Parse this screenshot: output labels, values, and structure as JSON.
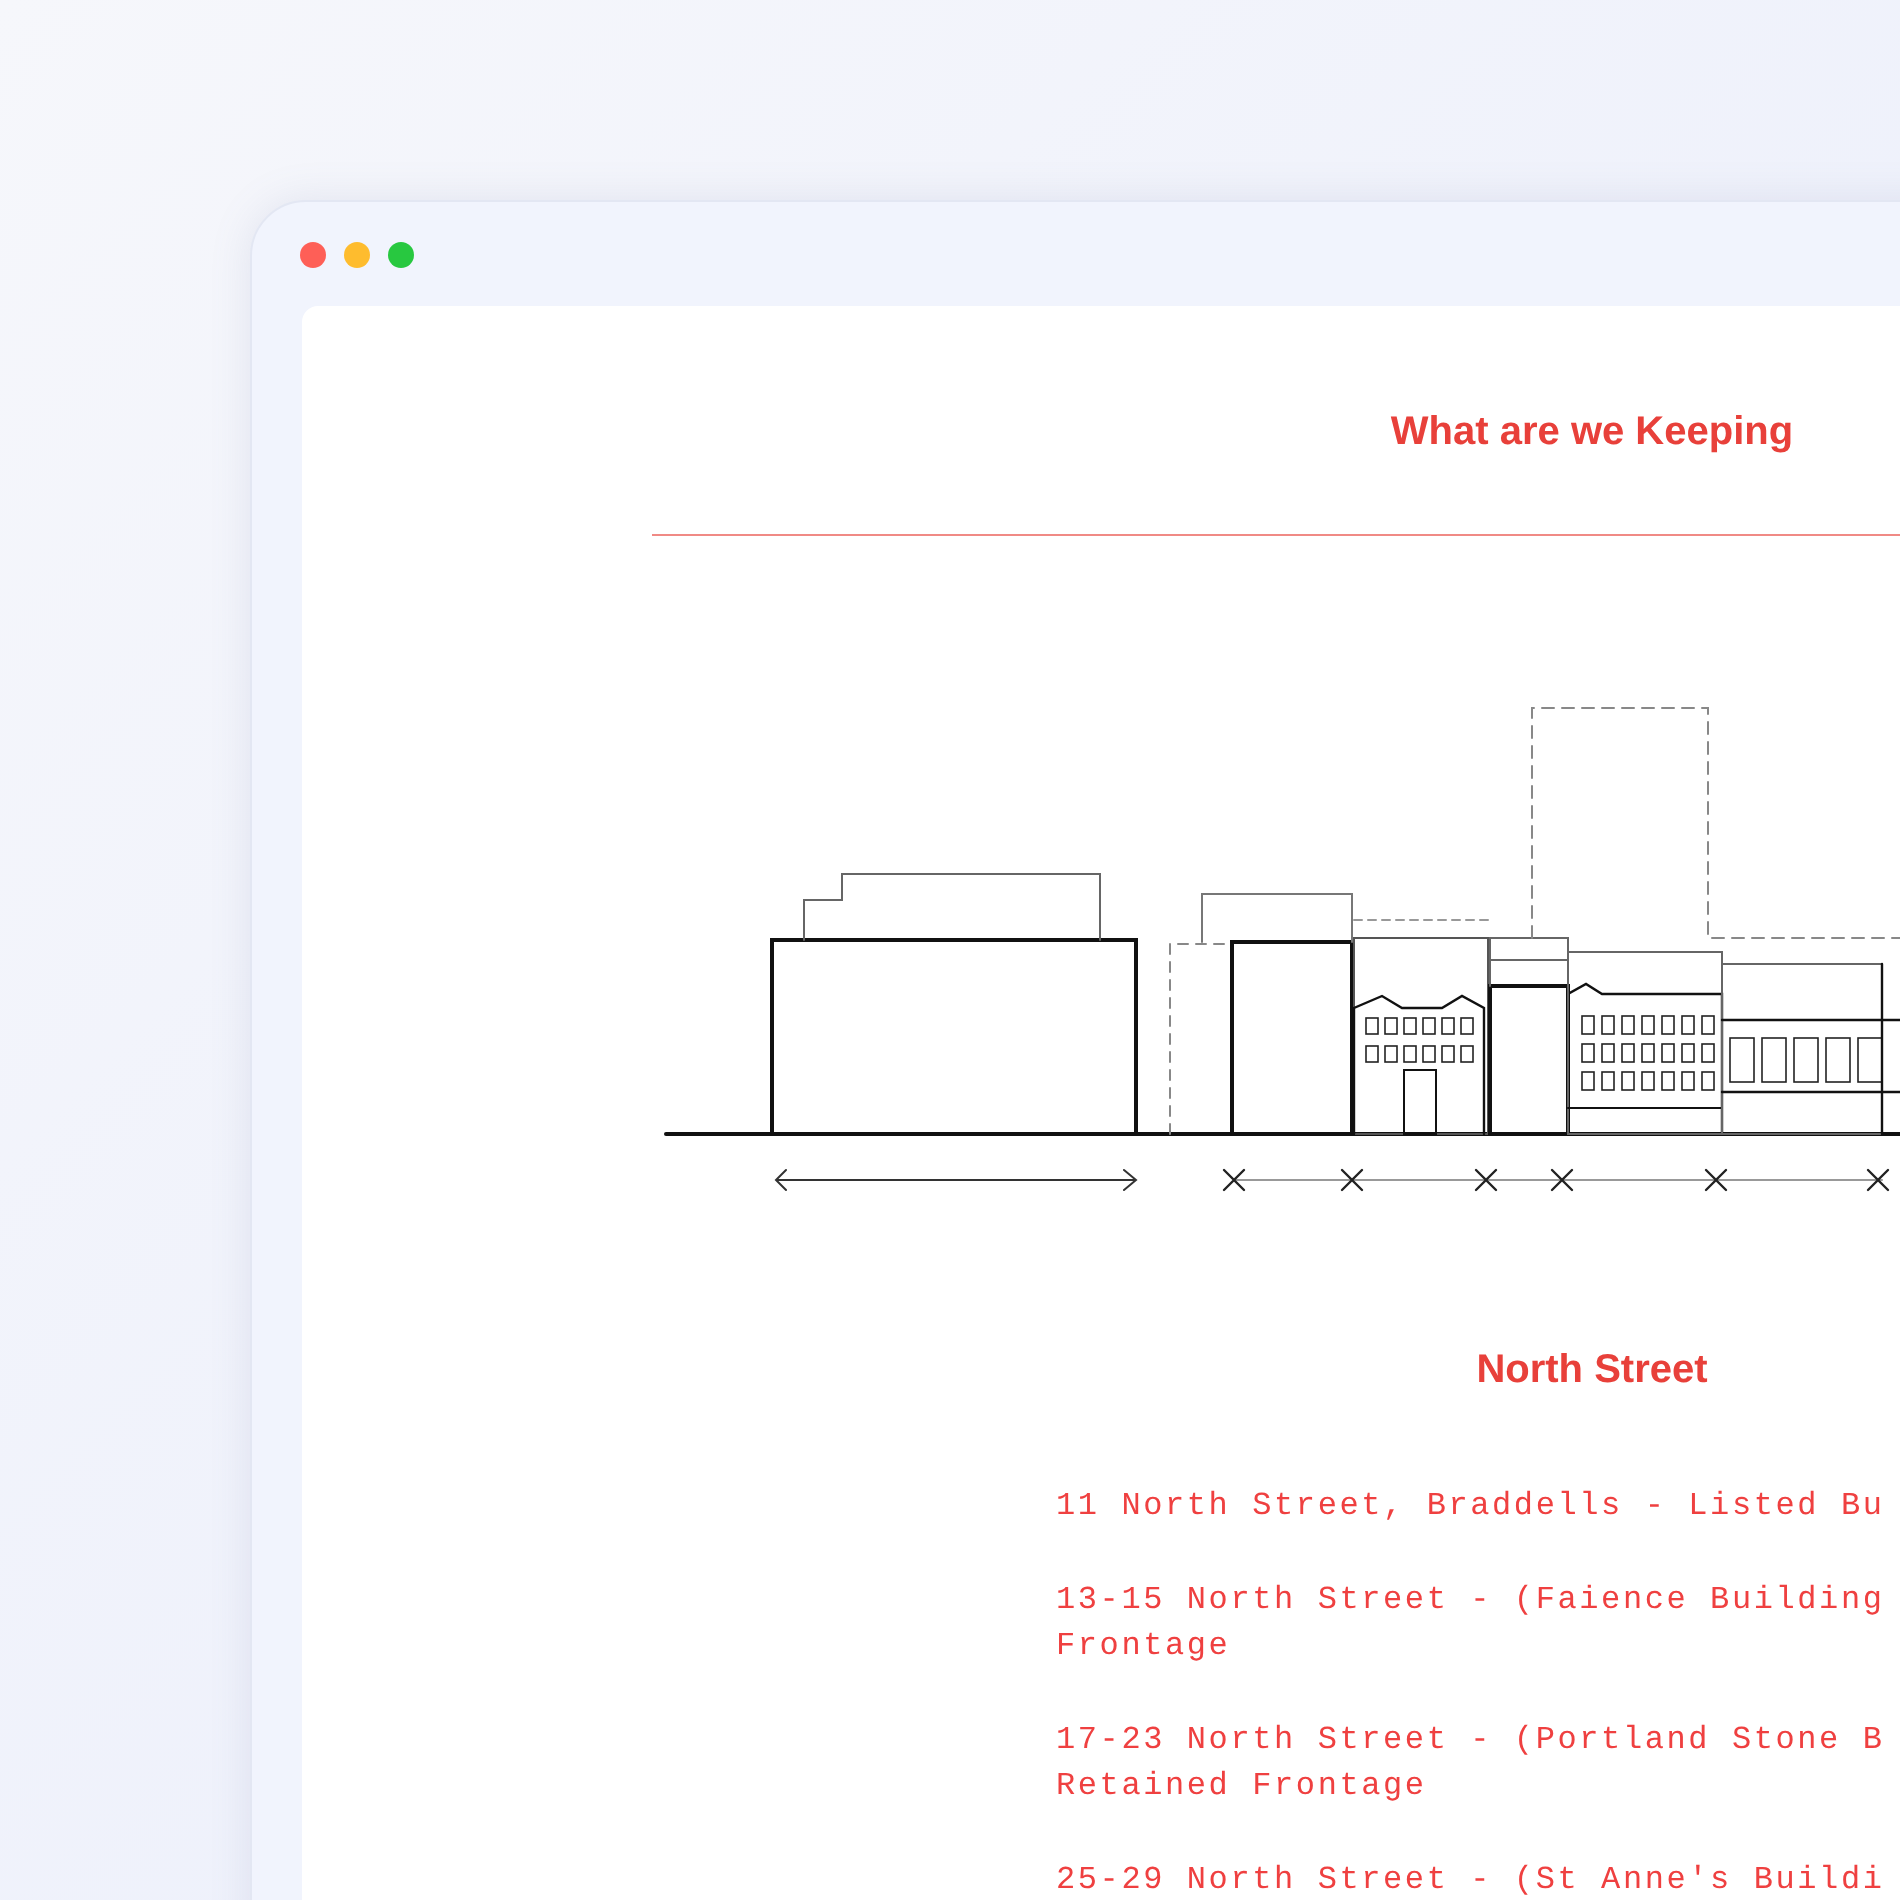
{
  "window": {
    "controls": [
      {
        "color": "#fe5f57"
      },
      {
        "color": "#febc2e"
      },
      {
        "color": "#28c840"
      }
    ]
  },
  "heading": "What are we Keeping",
  "section_title": "North Street",
  "items": [
    {
      "lines": [
        "11 North Street, Braddells - Listed Bu"
      ]
    },
    {
      "lines": [
        "13-15 North Street - (Faience Building",
        "Frontage"
      ]
    },
    {
      "lines": [
        "17-23 North Street - (Portland Stone B",
        "Retained Frontage"
      ]
    },
    {
      "lines": [
        "25-29 North Street - (St Anne's Buildi"
      ]
    }
  ]
}
